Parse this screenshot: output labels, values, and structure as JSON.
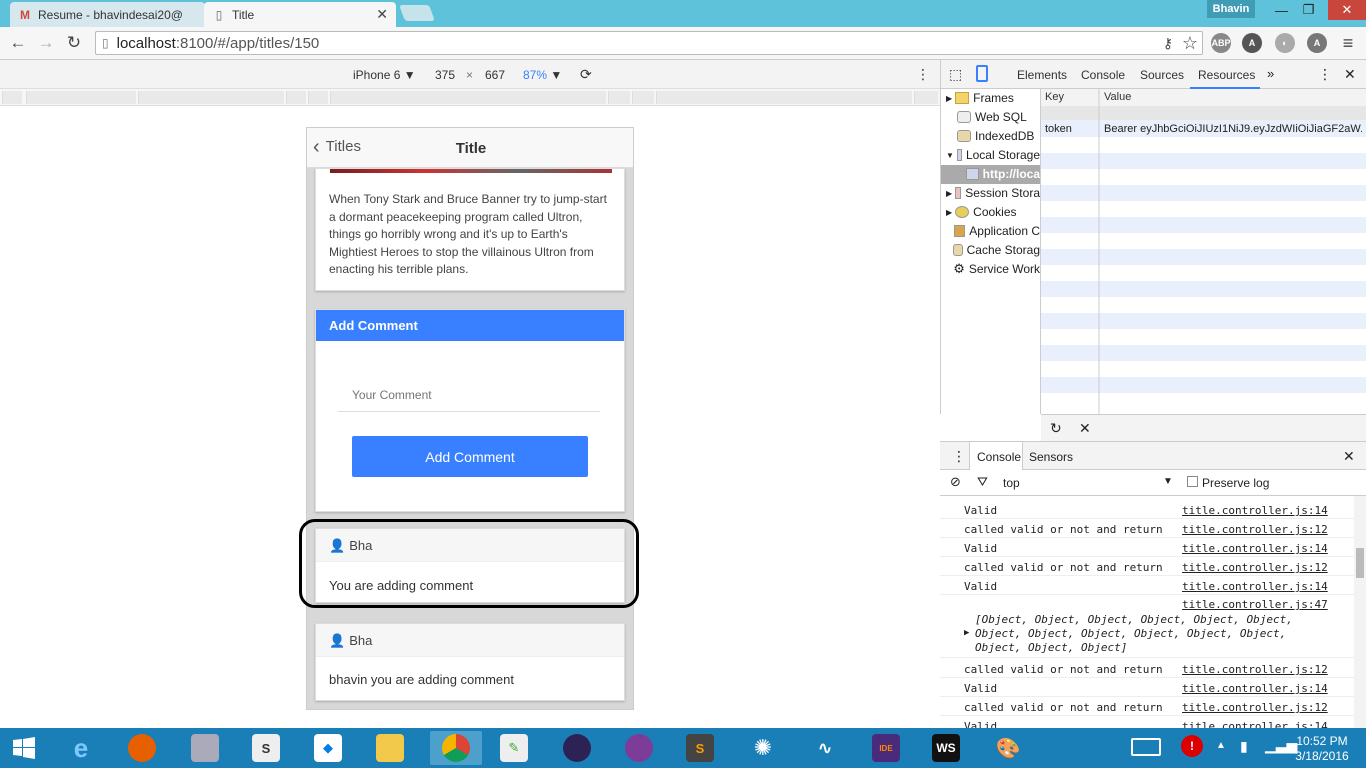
{
  "browser": {
    "tabs": [
      {
        "label": "Resume - bhavindesai20@",
        "icon": "gmail-icon",
        "active": false
      },
      {
        "label": "Title",
        "icon": "page-icon",
        "active": true
      }
    ],
    "user": "Bhavin",
    "address": {
      "host": "localhost",
      "path": ":8100/#/app/titles/150"
    }
  },
  "device_toolbar": {
    "device": "iPhone 6",
    "width": "375",
    "times": "×",
    "height": "667",
    "zoom": "87%"
  },
  "app": {
    "header": {
      "back_label": "Titles",
      "title": "Title"
    },
    "description": "When Tony Stark and Bruce Banner try to jump-start a dormant peacekeeping program called Ultron, things go horribly wrong and it's up to Earth's Mightiest Heroes to stop the villainous Ultron from enacting his terrible plans.",
    "add_comment": {
      "header": "Add Comment",
      "placeholder": "Your Comment",
      "button_label": "Add Comment"
    },
    "comments": [
      {
        "user": "Bha",
        "text": "You are adding comment"
      },
      {
        "user": "Bha",
        "text": "bhavin you are adding comment"
      }
    ]
  },
  "devtools": {
    "tabs": [
      "Elements",
      "Console",
      "Sources",
      "Resources"
    ],
    "active_tab": "Resources",
    "tree": [
      {
        "label": "Frames",
        "icon": "folder-icon"
      },
      {
        "label": "Web SQL",
        "icon": "database-icon"
      },
      {
        "label": "IndexedDB",
        "icon": "database-icon"
      },
      {
        "label": "Local Storage",
        "icon": "grid-icon"
      },
      {
        "label": "http://loca",
        "icon": "grid-icon"
      },
      {
        "label": "Session Stora",
        "icon": "grid-icon"
      },
      {
        "label": "Cookies",
        "icon": "cookie-icon"
      },
      {
        "label": "Application C",
        "icon": "database-icon"
      },
      {
        "label": "Cache Storag",
        "icon": "database-icon"
      },
      {
        "label": "Service Work",
        "icon": "gear-icon"
      }
    ],
    "storage": {
      "columns": [
        "Key",
        "Value"
      ],
      "rows": [
        {
          "key": "token",
          "value": "Bearer eyJhbGciOiJIUzI1NiJ9.eyJzdWIiOiJiaGF2aW..."
        }
      ]
    },
    "drawer_tabs": [
      "Console",
      "Sensors"
    ],
    "filter": {
      "context": "top",
      "preserve_log": "Preserve log"
    },
    "console": [
      {
        "msg": "Valid",
        "src": "title.controller.js:14"
      },
      {
        "msg": "called valid or not and return",
        "src": "title.controller.js:12"
      },
      {
        "msg": "Valid",
        "src": "title.controller.js:14"
      },
      {
        "msg": "called valid or not and return",
        "src": "title.controller.js:12"
      },
      {
        "msg": "Valid",
        "src": "title.controller.js:14"
      },
      {
        "msg": "",
        "src": "title.controller.js:47"
      },
      {
        "msg": "called valid or not and return",
        "src": "title.controller.js:12"
      },
      {
        "msg": "Valid",
        "src": "title.controller.js:14"
      },
      {
        "msg": "called valid or not and return",
        "src": "title.controller.js:12"
      },
      {
        "msg": "Valid",
        "src": "title.controller.js:14"
      }
    ],
    "object_dump": [
      "[Object, Object, Object, Object, Object, Object,",
      "Object, Object, Object, Object, Object, Object,",
      "Object, Object, Object]"
    ]
  },
  "taskbar": {
    "time": "10:52 PM",
    "date": "3/18/2016"
  },
  "colors": {
    "accent": "#3880ff",
    "titlebar": "#5dc2da",
    "taskbar": "#1b7fb7",
    "highlight_border": "#000000"
  }
}
